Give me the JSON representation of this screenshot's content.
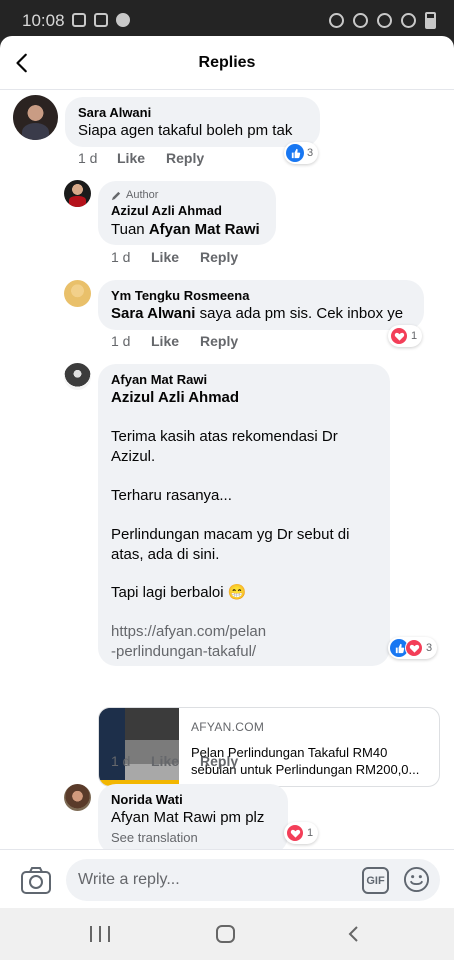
{
  "status": {
    "time": "10:08"
  },
  "header": {
    "title": "Replies"
  },
  "comments": [
    {
      "name": "Sara Alwani",
      "text": "Siapa agen takaful boleh pm tak",
      "time": "1 d",
      "like": "Like",
      "reply": "Reply",
      "reaction_count": "3"
    },
    {
      "badge": "Author",
      "name": "Azizul Azli Ahmad",
      "prefix": "Tuan ",
      "mention": "Afyan Mat Rawi",
      "time": "1 d",
      "like": "Like",
      "reply": "Reply"
    },
    {
      "name": "Ym Tengku Rosmeena",
      "mention": "Sara Alwani",
      "suffix": " saya ada pm sis. Cek inbox ye",
      "time": "1 d",
      "like": "Like",
      "reply": "Reply",
      "reaction_count": "1"
    },
    {
      "name": "Afyan Mat Rawi",
      "mention": "Azizul Azli Ahmad",
      "p1": "Terima kasih atas rekomendasi Dr Azizul.",
      "p2": "Terharu rasanya...",
      "p3": "Perlindungan macam yg Dr sebut di atas, ada di sini.",
      "p4": "Tapi lagi berbaloi 😁",
      "link_line1": "https://afyan.com/pelan",
      "link_line2": "-perlindungan-takaful/",
      "reaction_count": "3",
      "time": "1 d",
      "like": "Like",
      "reply": "Reply",
      "preview": {
        "domain": "AFYAN.COM",
        "title": "Pelan Perlindungan Takaful RM40 sebulan untuk Perlindungan RM200,0..."
      }
    },
    {
      "name": "Norida Wati",
      "text": "Afyan Mat Rawi pm plz",
      "see_translation": "See translation",
      "reaction_count": "1"
    }
  ],
  "composer": {
    "placeholder": "Write a reply...",
    "gif_label": "GIF"
  },
  "colors": {
    "like": "#1877f2",
    "love": "#f33e58",
    "bubble": "#f0f2f5"
  }
}
